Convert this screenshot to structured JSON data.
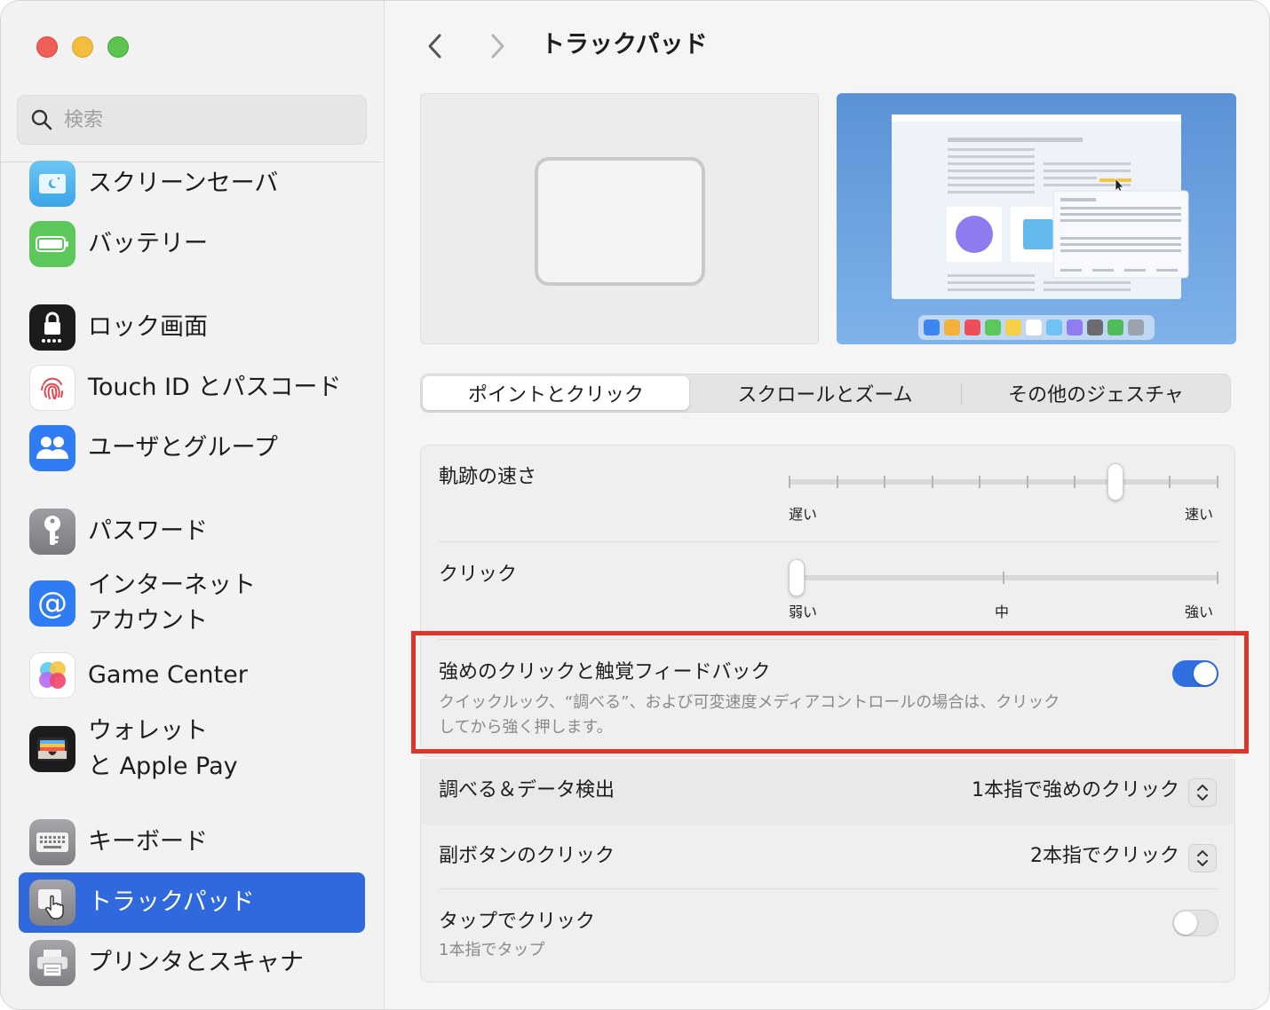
{
  "sidebar": {
    "search_placeholder": "検索",
    "items": [
      {
        "label": "スクリーンセーバ",
        "icon": "screensaver-icon"
      },
      {
        "label": "バッテリー",
        "icon": "battery-icon"
      },
      {
        "label": "ロック画面",
        "icon": "lock-icon"
      },
      {
        "label": "Touch ID とパスコード",
        "icon": "fingerprint-icon"
      },
      {
        "label": "ユーザとグループ",
        "icon": "users-icon"
      },
      {
        "label": "パスワード",
        "icon": "key-icon"
      },
      {
        "label": "インターネット\nアカウント",
        "line1": "インターネット",
        "line2": "アカウント",
        "icon": "at-icon"
      },
      {
        "label": "Game Center",
        "icon": "game-center-icon"
      },
      {
        "label": "ウォレット\nと Apple Pay",
        "line1": "ウォレット",
        "line2": "と Apple Pay",
        "icon": "wallet-icon"
      },
      {
        "label": "キーボード",
        "icon": "keyboard-icon"
      },
      {
        "label": "トラックパッド",
        "icon": "trackpad-icon",
        "selected": true
      },
      {
        "label": "プリンタとスキャナ",
        "icon": "printer-icon"
      }
    ]
  },
  "header": {
    "title": "トラックパッド"
  },
  "tabs": [
    {
      "label": "ポイントとクリック",
      "active": true
    },
    {
      "label": "スクロールとズーム",
      "active": false
    },
    {
      "label": "その他のジェスチャ",
      "active": false
    }
  ],
  "settings": {
    "tracking_speed": {
      "label": "軌跡の速さ",
      "min_label": "遅い",
      "max_label": "速い",
      "value_fraction": 0.77,
      "ticks": 10
    },
    "click": {
      "label": "クリック",
      "min_label": "弱い",
      "mid_label": "中",
      "max_label": "強い",
      "value_fraction": 0.0,
      "ticks": 3
    },
    "force_click": {
      "label": "強めのクリックと触覚フィードバック",
      "description_line1": "クイックルック、“調べる”、および可変速度メディアコントロールの場合は、クリック",
      "description_line2": "してから強く押します。",
      "enabled": true
    },
    "lookup": {
      "label": "調べる＆データ検出",
      "value": "1本指で強めのクリック"
    },
    "secondary_click": {
      "label": "副ボタンのクリック",
      "value": "2本指でクリック"
    },
    "tap_to_click": {
      "label": "タップでクリック",
      "sub": "1本指でタップ",
      "enabled": false
    }
  },
  "colors": {
    "accent": "#2f69dd",
    "highlight_box": "#d8372a"
  }
}
